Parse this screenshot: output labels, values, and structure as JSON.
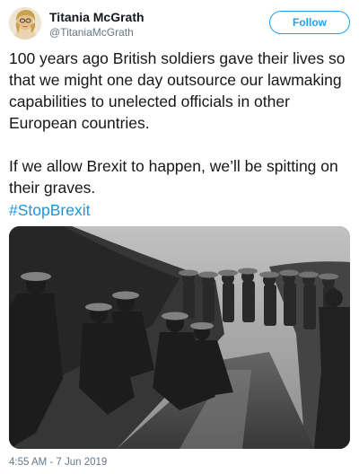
{
  "author": {
    "display_name": "Titania McGrath",
    "handle": "@TitaniaMcGrath"
  },
  "follow_button": {
    "label": "Follow"
  },
  "tweet": {
    "paragraph_1": "100 years ago British soldiers gave their lives so that we might one day outsource our lawmaking capabilities to unelected officials in other European countries.",
    "paragraph_2": "If we allow Brexit to happen, we’ll be spitting on their graves.",
    "hashtag": "#StopBrexit",
    "timestamp": "4:55 AM - 7 Jun 2019"
  },
  "colors": {
    "accent": "#1da1f2",
    "hashtag": "#1b95e0",
    "muted_text": "#657786",
    "text": "#14171a"
  },
  "media": {
    "type": "black-and-white photograph of soldiers resting in a trench"
  }
}
